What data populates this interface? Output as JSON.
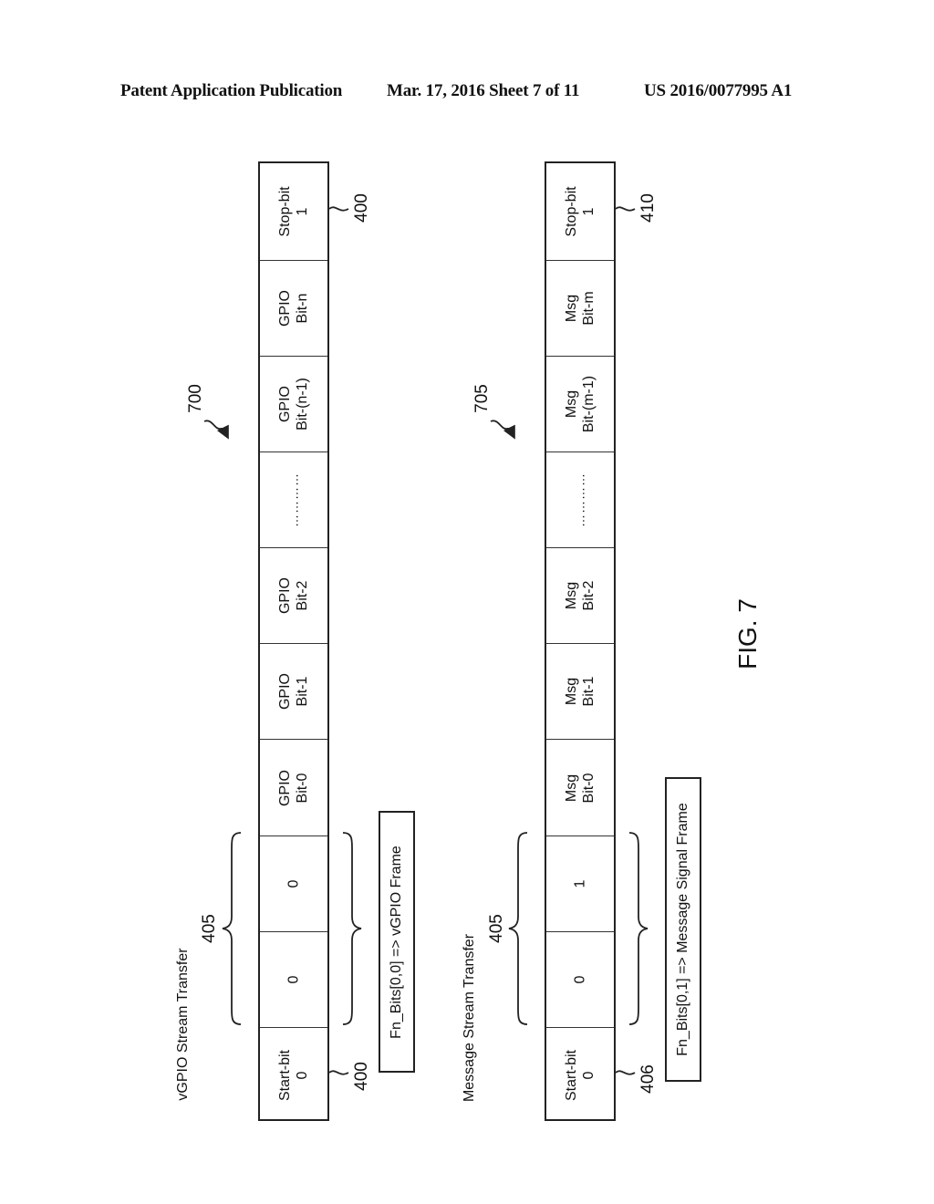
{
  "header": {
    "left": "Patent Application Publication",
    "middle": "Mar. 17, 2016  Sheet 7 of 11",
    "right": "US 2016/0077995 A1"
  },
  "figure_label": "FIG. 7",
  "frames": [
    {
      "id": "vgpio",
      "title": "vGPIO Stream Transfer",
      "ref": "700",
      "bracket_ref": "405",
      "start_ref": "400",
      "stop_ref": "400",
      "function_bits": "Fn_Bits[0,0] => vGPIO Frame",
      "cells": [
        {
          "lines": [
            "Stop-bit",
            "1"
          ]
        },
        {
          "lines": [
            "GPIO",
            "Bit-n"
          ]
        },
        {
          "lines": [
            "GPIO",
            "Bit-(n-1)"
          ]
        },
        {
          "lines": [
            "…………"
          ]
        },
        {
          "lines": [
            "GPIO",
            "Bit-2"
          ]
        },
        {
          "lines": [
            "GPIO",
            "Bit-1"
          ]
        },
        {
          "lines": [
            "GPIO",
            "Bit-0"
          ]
        },
        {
          "lines": [
            "0"
          ]
        },
        {
          "lines": [
            "0"
          ]
        },
        {
          "lines": [
            "Start-bit",
            "0"
          ]
        }
      ]
    },
    {
      "id": "msg",
      "title": "Message Stream Transfer",
      "ref": "705",
      "bracket_ref": "405",
      "start_ref": "406",
      "stop_ref": "410",
      "function_bits": "Fn_Bits[0,1] => Message Signal Frame",
      "cells": [
        {
          "lines": [
            "Stop-bit",
            "1"
          ]
        },
        {
          "lines": [
            "Msg",
            "Bit-m"
          ]
        },
        {
          "lines": [
            "Msg",
            "Bit-(m-1)"
          ]
        },
        {
          "lines": [
            "…………"
          ]
        },
        {
          "lines": [
            "Msg",
            "Bit-2"
          ]
        },
        {
          "lines": [
            "Msg",
            "Bit-1"
          ]
        },
        {
          "lines": [
            "Msg",
            "Bit-0"
          ]
        },
        {
          "lines": [
            "1"
          ]
        },
        {
          "lines": [
            "0"
          ]
        },
        {
          "lines": [
            "Start-bit",
            "0"
          ]
        }
      ]
    }
  ]
}
